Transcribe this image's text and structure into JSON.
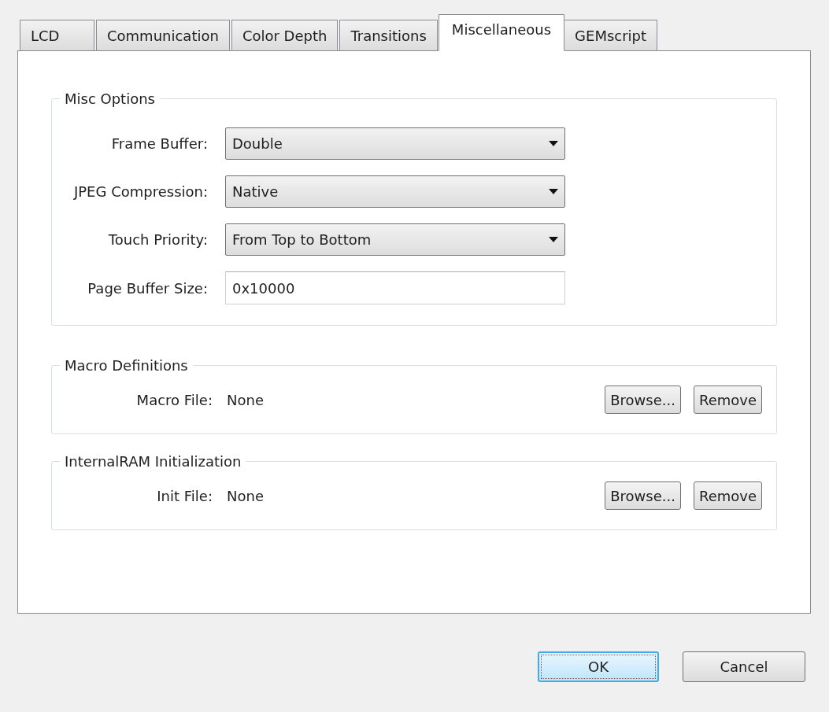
{
  "tabs": [
    {
      "label": "LCD",
      "selected": false
    },
    {
      "label": "Communication",
      "selected": false
    },
    {
      "label": "Color Depth",
      "selected": false
    },
    {
      "label": "Transitions",
      "selected": false
    },
    {
      "label": "Miscellaneous",
      "selected": true
    },
    {
      "label": "GEMscript",
      "selected": false
    }
  ],
  "misc_options": {
    "title": "Misc Options",
    "rows": [
      {
        "kind": "dropdown",
        "label": "Frame Buffer:",
        "value": "Double"
      },
      {
        "kind": "dropdown",
        "label": "JPEG Compression:",
        "value": "Native"
      },
      {
        "kind": "dropdown",
        "label": "Touch Priority:",
        "value": "From Top to Bottom"
      },
      {
        "kind": "text",
        "label": "Page Buffer Size:",
        "value": "0x10000"
      }
    ]
  },
  "file_groups": [
    {
      "title": "Macro Definitions",
      "label": "Macro File:",
      "value": "None",
      "buttons": [
        "Browse...",
        "Remove"
      ]
    },
    {
      "title": "InternalRAM Initialization",
      "label": "Init File:",
      "value": "None",
      "buttons": [
        "Browse...",
        "Remove"
      ]
    }
  ],
  "buttons": [
    {
      "label": "OK",
      "default": true
    },
    {
      "label": "Cancel",
      "default": false
    }
  ]
}
